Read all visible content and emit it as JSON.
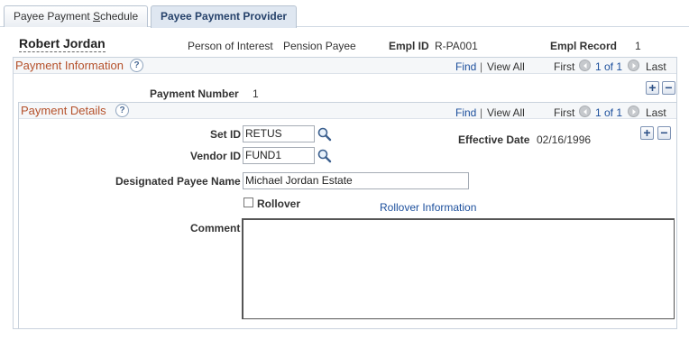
{
  "tabs": [
    {
      "label_before": "Payee Payment ",
      "label_underlined": "S",
      "label_after": "chedule"
    },
    {
      "label": "Payee Payment Provider"
    }
  ],
  "person": {
    "name": "Robert Jordan",
    "type_label": "Person of Interest",
    "type_value": "Pension Payee",
    "empl_id_label": "Empl ID",
    "empl_id_value": "R-PA001",
    "empl_record_label": "Empl Record",
    "empl_record_value": "1"
  },
  "payment_info": {
    "title": "Payment Information",
    "help": "?",
    "find": "Find",
    "sep": "|",
    "view_all": "View All",
    "first": "First",
    "count": "1 of 1",
    "last": "Last",
    "payment_number_label": "Payment Number",
    "payment_number_value": "1",
    "add": "+",
    "remove": "−"
  },
  "payment_details": {
    "title": "Payment Details",
    "help": "?",
    "find": "Find",
    "sep": "|",
    "view_all": "View All",
    "first": "First",
    "count": "1 of 1",
    "last": "Last",
    "add": "+",
    "remove": "−",
    "set_id_label": "Set ID",
    "set_id_value": "RETUS",
    "vendor_id_label": "Vendor ID",
    "vendor_id_value": "FUND1",
    "effective_date_label": "Effective Date",
    "effective_date_value": "02/16/1996",
    "designated_payee_label": "Designated Payee Name",
    "designated_payee_value": "Michael Jordan Estate",
    "rollover_label": "Rollover",
    "rollover_checked": false,
    "rollover_info_link": "Rollover Information",
    "comment_label": "Comment",
    "comment_value": ""
  },
  "colors": {
    "section_title": "#b5512b",
    "link": "#1c4f9c",
    "active_tab_bg": "#dfe7f1"
  }
}
